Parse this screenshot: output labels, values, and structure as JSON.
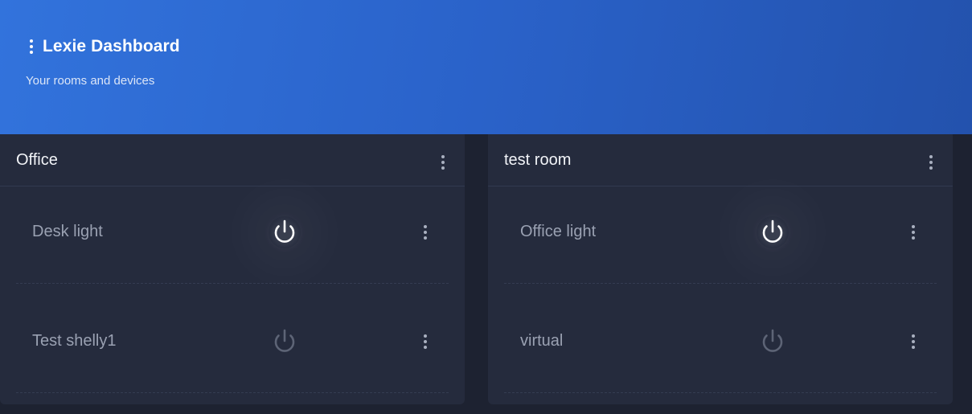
{
  "header": {
    "title": "Lexie Dashboard",
    "subtitle": "Your rooms and devices",
    "menu_icon": "kebab-menu-icon"
  },
  "colors": {
    "header_gradient_start": "#3273dc",
    "header_gradient_end": "#2352ad",
    "background": "#1d2231",
    "card": "#252b3d",
    "power_on": "#ffffff",
    "power_off": "#5d6476"
  },
  "rooms": [
    {
      "name": "Office",
      "devices": [
        {
          "name": "Desk light",
          "state": "on",
          "icon": "power-icon"
        },
        {
          "name": "Test shelly1",
          "state": "off",
          "icon": "power-icon"
        }
      ]
    },
    {
      "name": "test room",
      "devices": [
        {
          "name": "Office light",
          "state": "on",
          "icon": "power-icon"
        },
        {
          "name": "virtual",
          "state": "off",
          "icon": "power-icon"
        }
      ]
    }
  ]
}
